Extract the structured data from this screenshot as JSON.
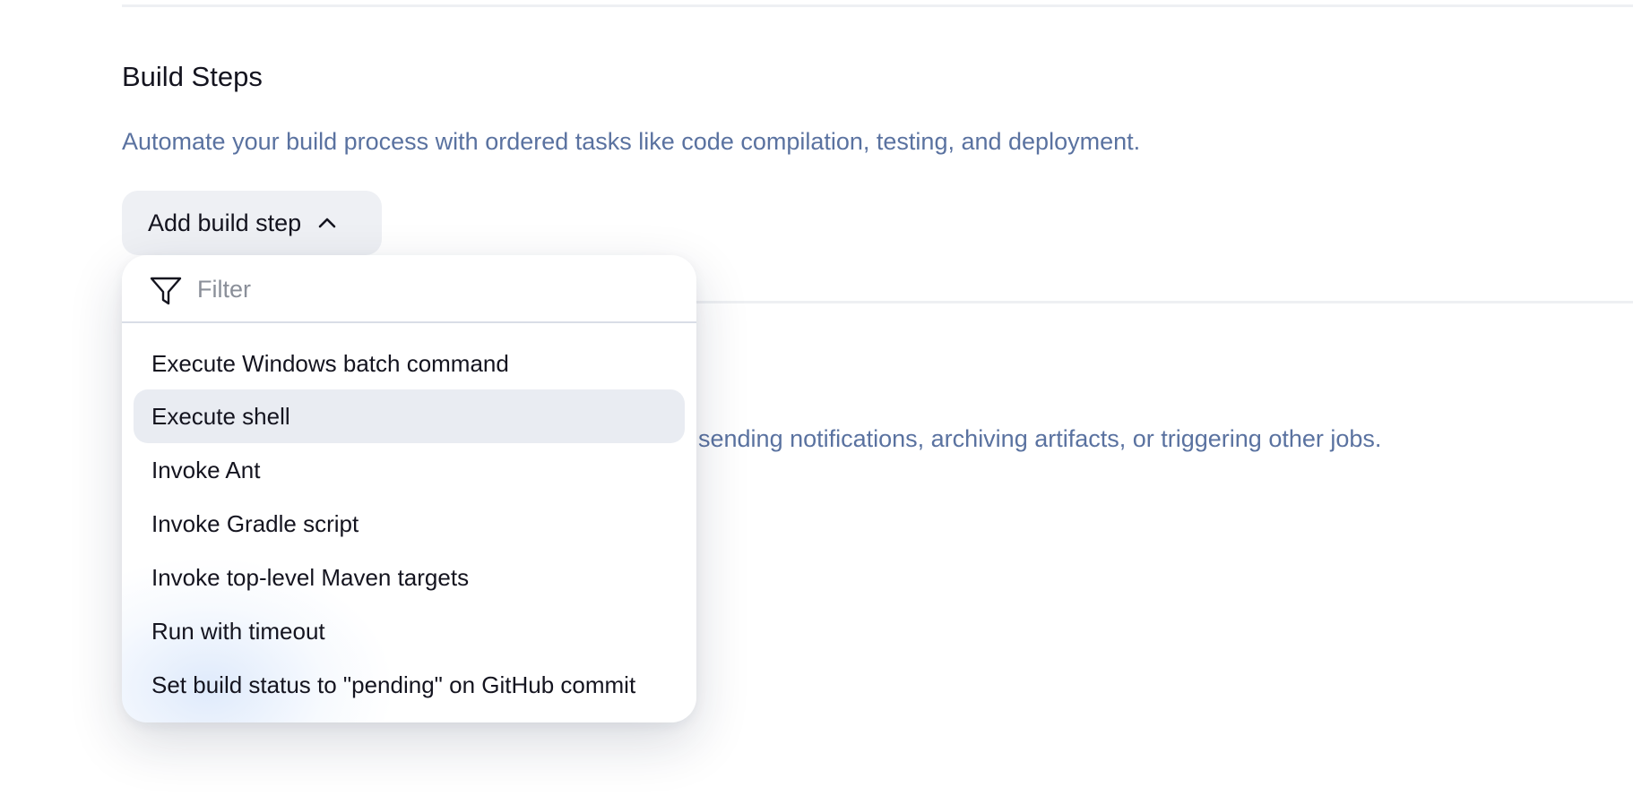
{
  "build_steps": {
    "title": "Build Steps",
    "description": "Automate your build process with ordered tasks like code compilation, testing, and deployment.",
    "add_button_label": "Add build step",
    "add_button_icon": "chevron-up-icon"
  },
  "post_build": {
    "description_visible": "sending notifications, archiving artifacts, or triggering other jobs."
  },
  "dropdown": {
    "filter_placeholder": "Filter",
    "filter_icon": "filter-funnel-icon",
    "items": [
      {
        "label": "Execute Windows batch command"
      },
      {
        "label": "Execute shell",
        "highlighted": true
      },
      {
        "label": "Invoke Ant"
      },
      {
        "label": "Invoke Gradle script"
      },
      {
        "label": "Invoke top-level Maven targets"
      },
      {
        "label": "Run with timeout"
      },
      {
        "label": "Set build status to \"pending\" on GitHub commit"
      }
    ]
  },
  "colors": {
    "description_text": "#5a72a0",
    "button_bg": "#eef0f4",
    "highlight_bg": "#e9ecf2",
    "divider": "#eef0f3"
  }
}
